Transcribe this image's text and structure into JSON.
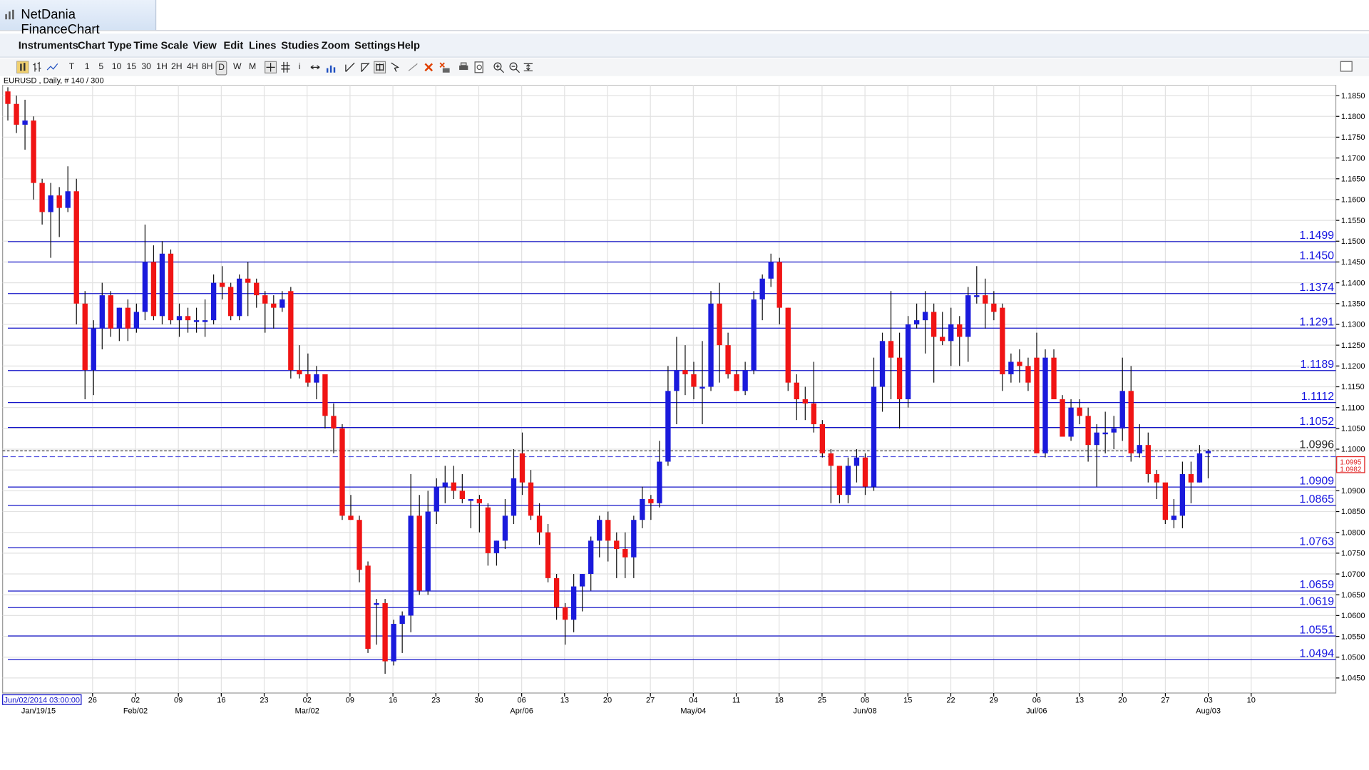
{
  "window": {
    "title": "NetDania FinanceChart"
  },
  "menu": [
    "Instruments",
    "Chart Type",
    "Time Scale",
    "View",
    "Edit",
    "Lines",
    "Studies",
    "Zoom",
    "Settings",
    "Help"
  ],
  "toolbar": {
    "timeframes": [
      "T",
      "1",
      "5",
      "10",
      "15",
      "30",
      "1H",
      "2H",
      "4H",
      "8H",
      "D",
      "W",
      "M"
    ],
    "selected_timeframe": "D"
  },
  "symbol_label": "EURUSD , Daily, # 140 / 300",
  "chart_data": {
    "type": "candlestick",
    "y_ticks": [
      "1.1850",
      "1.1800",
      "1.1750",
      "1.1700",
      "1.1650",
      "1.1600",
      "1.1550",
      "1.1500",
      "1.1450",
      "1.1400",
      "1.1350",
      "1.1300",
      "1.1250",
      "1.1200",
      "1.1150",
      "1.1100",
      "1.1050",
      "1.1000",
      "1.0950",
      "1.0900",
      "1.0850",
      "1.0800",
      "1.0750",
      "1.0700",
      "1.0650",
      "1.0600",
      "1.0550",
      "1.0500",
      "1.0450"
    ],
    "ylim": [
      1.043,
      1.187
    ],
    "horizontal_levels": [
      "1.1499",
      "1.1450",
      "1.1374",
      "1.1291",
      "1.1189",
      "1.1112",
      "1.1052",
      "1.0909",
      "1.0865",
      "1.0763",
      "1.0659",
      "1.0619",
      "1.0551",
      "1.0494"
    ],
    "current_level": "1.0996",
    "last_price_badge": [
      "1.0995",
      "1.0982"
    ],
    "x_ticks": [
      "26",
      "02",
      "09",
      "16",
      "23",
      "02",
      "09",
      "16",
      "23",
      "30",
      "06",
      "13",
      "20",
      "27",
      "04",
      "11",
      "18",
      "25",
      "08",
      "15",
      "22",
      "29",
      "06",
      "13",
      "20",
      "27",
      "03",
      "10"
    ],
    "x_month_labels": [
      "Jan/19/15",
      "Feb/02",
      "Mar/02",
      "Apr/06",
      "May/04",
      "Jun/08",
      "Jul/06",
      "Aug/03"
    ],
    "cursor_date_label": "Jun/02/2014 03:00:00",
    "ohlc": [
      [
        1.186,
        1.187,
        1.179,
        1.183
      ],
      [
        1.183,
        1.185,
        1.176,
        1.178
      ],
      [
        1.178,
        1.184,
        1.172,
        1.179
      ],
      [
        1.179,
        1.18,
        1.16,
        1.164
      ],
      [
        1.164,
        1.165,
        1.154,
        1.157
      ],
      [
        1.157,
        1.164,
        1.146,
        1.161
      ],
      [
        1.161,
        1.163,
        1.151,
        1.158
      ],
      [
        1.158,
        1.168,
        1.157,
        1.162
      ],
      [
        1.162,
        1.165,
        1.13,
        1.135
      ],
      [
        1.135,
        1.138,
        1.112,
        1.119
      ],
      [
        1.119,
        1.131,
        1.113,
        1.129
      ],
      [
        1.129,
        1.14,
        1.124,
        1.137
      ],
      [
        1.137,
        1.138,
        1.127,
        1.129
      ],
      [
        1.129,
        1.134,
        1.126,
        1.134
      ],
      [
        1.134,
        1.136,
        1.126,
        1.129
      ],
      [
        1.129,
        1.135,
        1.128,
        1.133
      ],
      [
        1.133,
        1.154,
        1.131,
        1.145
      ],
      [
        1.145,
        1.149,
        1.131,
        1.132
      ],
      [
        1.132,
        1.15,
        1.13,
        1.147
      ],
      [
        1.147,
        1.148,
        1.13,
        1.131
      ],
      [
        1.131,
        1.135,
        1.127,
        1.132
      ],
      [
        1.132,
        1.134,
        1.128,
        1.131
      ],
      [
        1.131,
        1.134,
        1.128,
        1.131
      ],
      [
        1.131,
        1.136,
        1.127,
        1.131
      ],
      [
        1.131,
        1.142,
        1.13,
        1.14
      ],
      [
        1.14,
        1.144,
        1.136,
        1.139
      ],
      [
        1.139,
        1.14,
        1.131,
        1.132
      ],
      [
        1.132,
        1.142,
        1.131,
        1.141
      ],
      [
        1.141,
        1.145,
        1.132,
        1.14
      ],
      [
        1.14,
        1.141,
        1.134,
        1.137
      ],
      [
        1.137,
        1.138,
        1.128,
        1.135
      ],
      [
        1.135,
        1.137,
        1.129,
        1.134
      ],
      [
        1.134,
        1.138,
        1.133,
        1.136
      ],
      [
        1.138,
        1.139,
        1.117,
        1.119
      ],
      [
        1.119,
        1.125,
        1.117,
        1.118
      ],
      [
        1.118,
        1.123,
        1.115,
        1.116
      ],
      [
        1.116,
        1.12,
        1.112,
        1.118
      ],
      [
        1.118,
        1.118,
        1.105,
        1.108
      ],
      [
        1.108,
        1.111,
        1.099,
        1.105
      ],
      [
        1.105,
        1.106,
        1.083,
        1.084
      ],
      [
        1.084,
        1.089,
        1.083,
        1.083
      ],
      [
        1.083,
        1.084,
        1.068,
        1.071
      ],
      [
        1.072,
        1.073,
        1.051,
        1.052
      ],
      [
        1.063,
        1.064,
        1.053,
        1.063
      ],
      [
        1.063,
        1.064,
        1.046,
        1.049
      ],
      [
        1.049,
        1.059,
        1.048,
        1.058
      ],
      [
        1.058,
        1.061,
        1.051,
        1.06
      ],
      [
        1.06,
        1.094,
        1.056,
        1.084
      ],
      [
        1.084,
        1.089,
        1.065,
        1.066
      ],
      [
        1.066,
        1.09,
        1.065,
        1.085
      ],
      [
        1.085,
        1.093,
        1.082,
        1.091
      ],
      [
        1.091,
        1.096,
        1.087,
        1.092
      ],
      [
        1.092,
        1.096,
        1.088,
        1.09
      ],
      [
        1.09,
        1.094,
        1.087,
        1.088
      ],
      [
        1.088,
        1.088,
        1.081,
        1.088
      ],
      [
        1.088,
        1.089,
        1.08,
        1.087
      ],
      [
        1.086,
        1.087,
        1.072,
        1.075
      ],
      [
        1.075,
        1.078,
        1.072,
        1.078
      ],
      [
        1.078,
        1.088,
        1.076,
        1.084
      ],
      [
        1.084,
        1.1,
        1.082,
        1.093
      ],
      [
        1.099,
        1.104,
        1.089,
        1.092
      ],
      [
        1.092,
        1.095,
        1.083,
        1.084
      ],
      [
        1.084,
        1.087,
        1.077,
        1.08
      ],
      [
        1.08,
        1.082,
        1.068,
        1.069
      ],
      [
        1.069,
        1.07,
        1.059,
        1.062
      ],
      [
        1.062,
        1.063,
        1.053,
        1.059
      ],
      [
        1.059,
        1.07,
        1.056,
        1.067
      ],
      [
        1.067,
        1.07,
        1.061,
        1.07
      ],
      [
        1.07,
        1.079,
        1.066,
        1.078
      ],
      [
        1.078,
        1.084,
        1.074,
        1.083
      ],
      [
        1.083,
        1.085,
        1.073,
        1.078
      ],
      [
        1.078,
        1.08,
        1.069,
        1.076
      ],
      [
        1.076,
        1.08,
        1.069,
        1.074
      ],
      [
        1.074,
        1.084,
        1.069,
        1.083
      ],
      [
        1.083,
        1.091,
        1.081,
        1.088
      ],
      [
        1.088,
        1.089,
        1.083,
        1.087
      ],
      [
        1.087,
        1.102,
        1.086,
        1.097
      ],
      [
        1.097,
        1.12,
        1.096,
        1.114
      ],
      [
        1.114,
        1.127,
        1.106,
        1.119
      ],
      [
        1.119,
        1.125,
        1.113,
        1.118
      ],
      [
        1.118,
        1.121,
        1.112,
        1.115
      ],
      [
        1.115,
        1.126,
        1.106,
        1.115
      ],
      [
        1.115,
        1.138,
        1.114,
        1.135
      ],
      [
        1.135,
        1.14,
        1.116,
        1.125
      ],
      [
        1.125,
        1.128,
        1.117,
        1.118
      ],
      [
        1.118,
        1.119,
        1.114,
        1.114
      ],
      [
        1.114,
        1.121,
        1.113,
        1.119
      ],
      [
        1.119,
        1.138,
        1.118,
        1.136
      ],
      [
        1.136,
        1.142,
        1.131,
        1.141
      ],
      [
        1.141,
        1.147,
        1.139,
        1.145
      ],
      [
        1.145,
        1.146,
        1.13,
        1.134
      ],
      [
        1.134,
        1.134,
        1.114,
        1.116
      ],
      [
        1.116,
        1.118,
        1.107,
        1.112
      ],
      [
        1.112,
        1.115,
        1.107,
        1.111
      ],
      [
        1.111,
        1.121,
        1.104,
        1.106
      ],
      [
        1.106,
        1.107,
        1.098,
        1.099
      ],
      [
        1.099,
        1.1,
        1.087,
        1.096
      ],
      [
        1.096,
        1.095,
        1.087,
        1.089
      ],
      [
        1.089,
        1.098,
        1.087,
        1.096
      ],
      [
        1.096,
        1.1,
        1.092,
        1.098
      ],
      [
        1.098,
        1.099,
        1.089,
        1.091
      ],
      [
        1.091,
        1.122,
        1.09,
        1.115
      ],
      [
        1.115,
        1.128,
        1.109,
        1.126
      ],
      [
        1.126,
        1.138,
        1.112,
        1.122
      ],
      [
        1.122,
        1.128,
        1.105,
        1.112
      ],
      [
        1.112,
        1.132,
        1.11,
        1.13
      ],
      [
        1.13,
        1.135,
        1.129,
        1.131
      ],
      [
        1.131,
        1.138,
        1.123,
        1.133
      ],
      [
        1.133,
        1.135,
        1.116,
        1.127
      ],
      [
        1.127,
        1.133,
        1.125,
        1.126
      ],
      [
        1.126,
        1.134,
        1.12,
        1.13
      ],
      [
        1.13,
        1.132,
        1.12,
        1.127
      ],
      [
        1.127,
        1.139,
        1.121,
        1.137
      ],
      [
        1.137,
        1.144,
        1.135,
        1.137
      ],
      [
        1.137,
        1.141,
        1.129,
        1.135
      ],
      [
        1.135,
        1.138,
        1.131,
        1.133
      ],
      [
        1.134,
        1.135,
        1.114,
        1.118
      ],
      [
        1.118,
        1.123,
        1.116,
        1.121
      ],
      [
        1.121,
        1.124,
        1.116,
        1.12
      ],
      [
        1.12,
        1.122,
        1.114,
        1.116
      ],
      [
        1.122,
        1.128,
        1.11,
        1.099
      ],
      [
        1.099,
        1.124,
        1.098,
        1.122
      ],
      [
        1.122,
        1.124,
        1.112,
        1.112
      ],
      [
        1.112,
        1.113,
        1.103,
        1.103
      ],
      [
        1.103,
        1.112,
        1.102,
        1.11
      ],
      [
        1.11,
        1.112,
        1.106,
        1.108
      ],
      [
        1.108,
        1.11,
        1.097,
        1.101
      ],
      [
        1.101,
        1.106,
        1.091,
        1.104
      ],
      [
        1.104,
        1.109,
        1.099,
        1.104
      ],
      [
        1.104,
        1.108,
        1.1,
        1.105
      ],
      [
        1.105,
        1.122,
        1.102,
        1.114
      ],
      [
        1.114,
        1.12,
        1.097,
        1.099
      ],
      [
        1.099,
        1.106,
        1.098,
        1.101
      ],
      [
        1.101,
        1.104,
        1.092,
        1.094
      ],
      [
        1.094,
        1.095,
        1.088,
        1.092
      ],
      [
        1.092,
        1.09,
        1.082,
        1.083
      ],
      [
        1.083,
        1.088,
        1.081,
        1.084
      ],
      [
        1.084,
        1.097,
        1.081,
        1.094
      ],
      [
        1.094,
        1.097,
        1.087,
        1.092
      ],
      [
        1.092,
        1.101,
        1.092,
        1.099
      ],
      [
        1.099,
        1.1,
        1.093,
        1.0996
      ]
    ]
  },
  "colors": {
    "up": "#1a1adc",
    "down": "#f01414",
    "wick": "#111111",
    "level_line": "#1414c8",
    "level_text": "#1414e0",
    "grid": "#e2e2e2",
    "current_line": "#333333"
  }
}
